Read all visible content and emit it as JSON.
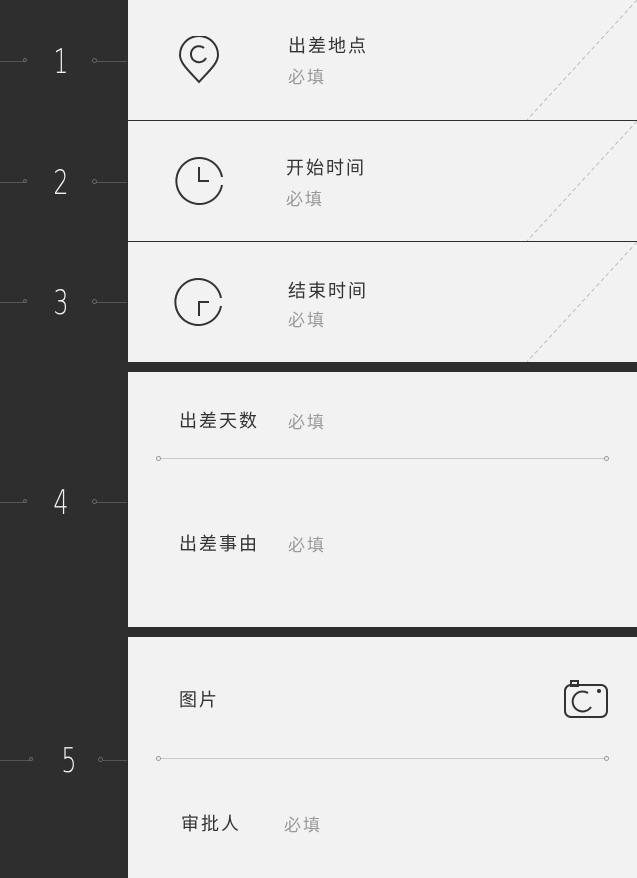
{
  "steps": [
    {
      "number": "1"
    },
    {
      "number": "2"
    },
    {
      "number": "3"
    },
    {
      "number": "4"
    },
    {
      "number": "5"
    }
  ],
  "fields": {
    "location": {
      "label": "出差地点",
      "placeholder": "必填",
      "icon": "location-pin-icon"
    },
    "start_time": {
      "label": "开始时间",
      "placeholder": "必填",
      "icon": "clock-icon"
    },
    "end_time": {
      "label": "结束时间",
      "placeholder": "必填",
      "icon": "clock-end-icon"
    },
    "days": {
      "label": "出差天数",
      "placeholder": "必填"
    },
    "reason": {
      "label": "出差事由",
      "placeholder": "必填"
    },
    "image": {
      "label": "图片",
      "icon": "camera-icon"
    },
    "approver": {
      "label": "审批人",
      "placeholder": "必填"
    }
  },
  "colors": {
    "background": "#2e2e2e",
    "card": "#f2f2f2",
    "text": "#333333",
    "placeholder": "#999999"
  }
}
